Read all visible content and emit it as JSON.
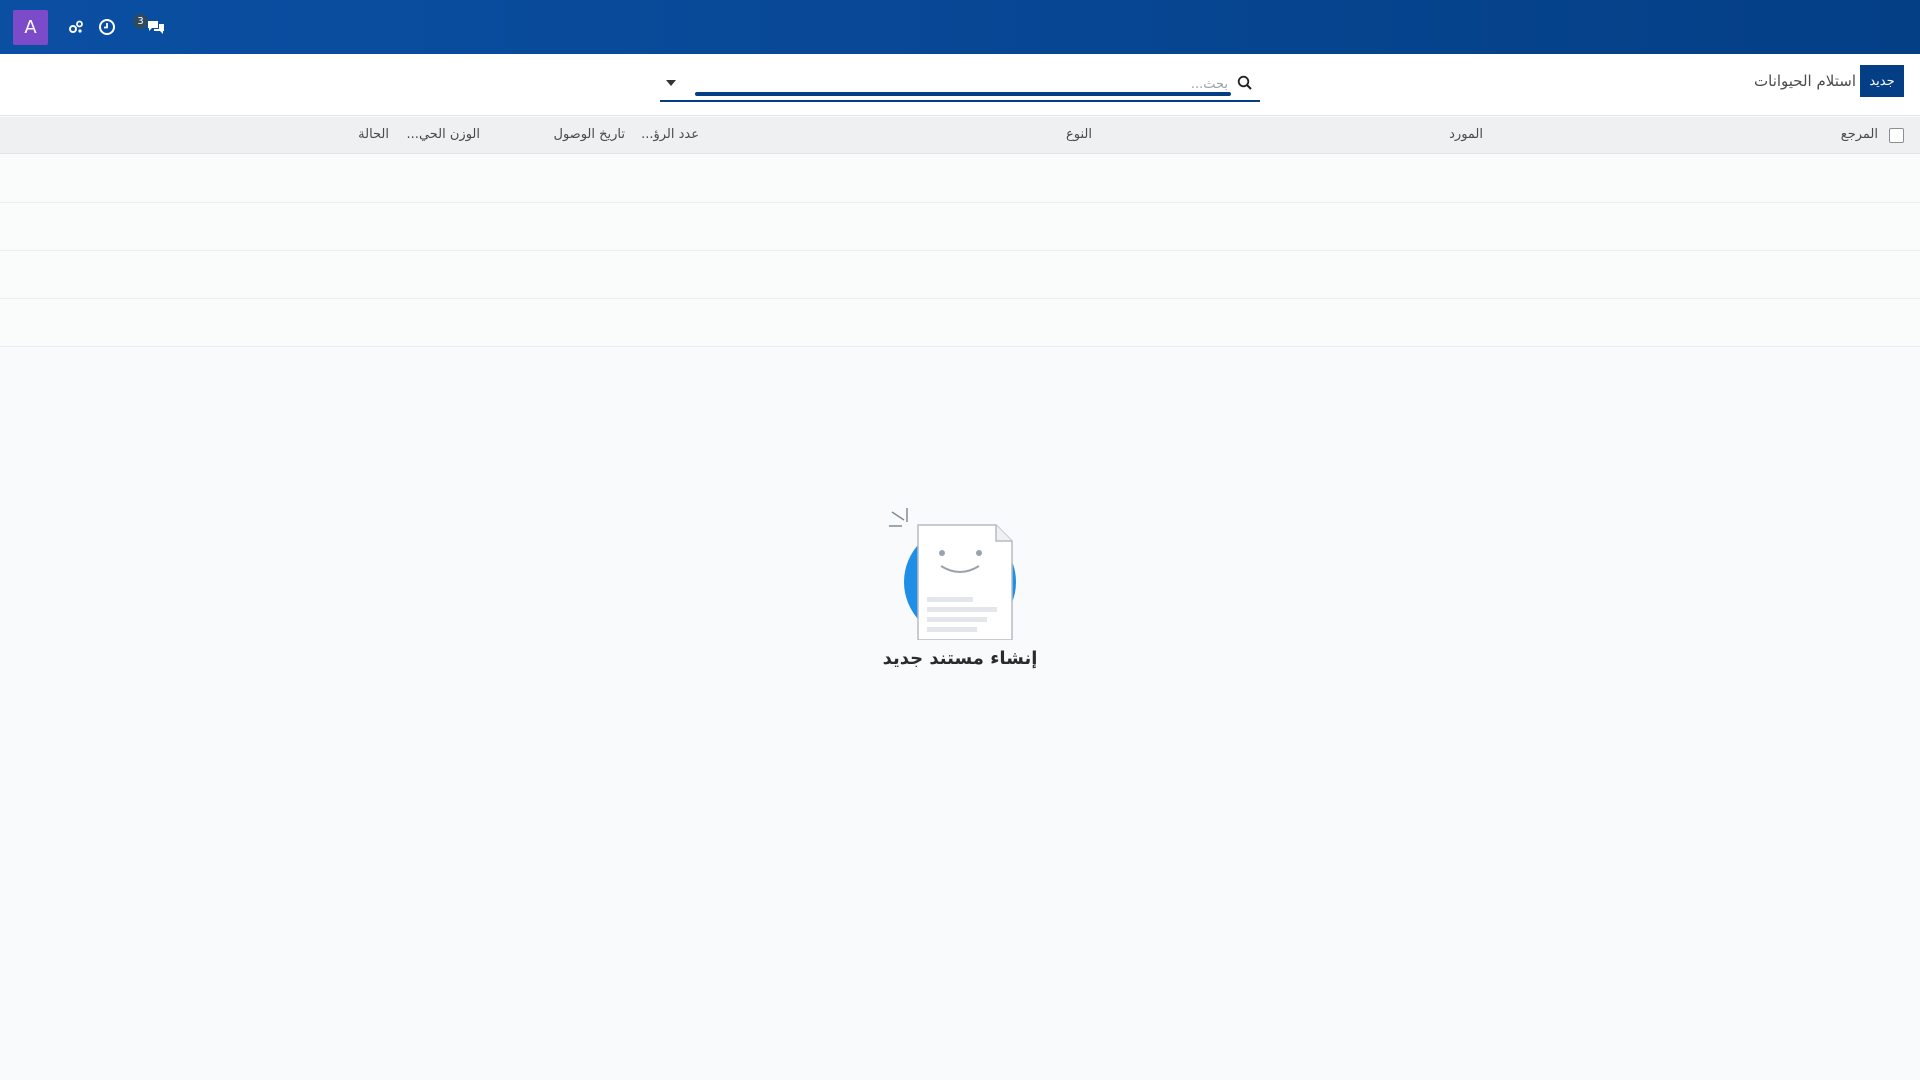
{
  "navbar": {
    "avatar_letter": "A",
    "messages_count": "3"
  },
  "control_panel": {
    "new_button_label": "جديد",
    "title": "استلام الحيوانات",
    "search_placeholder": "بحث..."
  },
  "list": {
    "columns": {
      "reference": "المرجع",
      "supplier": "المورد",
      "type": "النوع",
      "heads_count": "عدد الرؤ...",
      "arrival_date": "تاريخ الوصول",
      "live_weight": "الوزن الحي...",
      "status": "الحالة"
    }
  },
  "empty_state": {
    "title": "إنشاء مستند جديد"
  },
  "colors": {
    "navbar": "#0b4fa3",
    "primary": "#043f86",
    "avatar": "#7b4bc9",
    "illustration_circle": "#1e8ee6"
  }
}
